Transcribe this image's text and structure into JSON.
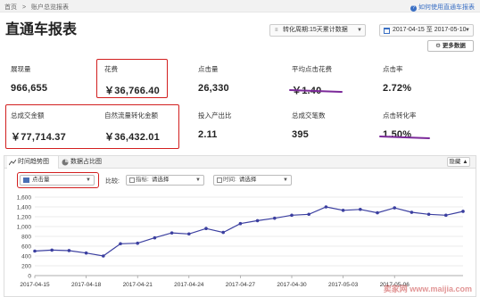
{
  "topbar": {
    "crumbs": [
      "首页",
      ">",
      "账户总览报表"
    ],
    "help": "如何使用直通车报表"
  },
  "title": "直通车报表",
  "controls": {
    "cycle": "转化周期:15天累计数据",
    "date_range": "2017-04-15 至 2017-05-10",
    "more": "更多数据"
  },
  "metrics": [
    {
      "label": "展现量",
      "value": "966,655"
    },
    {
      "label": "花费",
      "value": "￥36,766.40"
    },
    {
      "label": "点击量",
      "value": "26,330"
    },
    {
      "label": "平均点击花费",
      "value": "￥1.40"
    },
    {
      "label": "点击率",
      "value": "2.72%"
    },
    {
      "label": "总成交金额",
      "value": "￥77,714.37"
    },
    {
      "label": "自然流量转化金额",
      "value": "￥36,432.01"
    },
    {
      "label": "投入产出比",
      "value": "2.11"
    },
    {
      "label": "总成交笔数",
      "value": "395"
    },
    {
      "label": "点击转化率",
      "value": "1.50%"
    }
  ],
  "chart_panel": {
    "tabs": [
      "时间趋势图",
      "数据占比图"
    ],
    "hide": "隐藏",
    "metric_select": "点击量",
    "compare_label": "比较:",
    "index_select": {
      "key": "指标:",
      "value": "请选择"
    },
    "time_select": {
      "key": "时间:",
      "value": "请选择"
    },
    "watermark": "卖家网 www.maijia.com"
  },
  "colors": {
    "line": "#3b3fa0",
    "highlight_box": "#d21f1f",
    "underline": "#7c2a9a",
    "accent": "#3a6fc4"
  },
  "chart_data": {
    "type": "line",
    "title": "",
    "xlabel": "",
    "ylabel": "",
    "ylim": [
      0,
      1600
    ],
    "yticks": [
      0,
      200,
      400,
      600,
      800,
      1000,
      1200,
      1400,
      1600
    ],
    "xtick_labels": [
      "2017-04-15",
      "2017-04-18",
      "2017-04-21",
      "2017-04-24",
      "2017-04-27",
      "2017-04-30",
      "2017-05-03",
      "2017-05-06"
    ],
    "grid": true,
    "x": [
      "2017-04-15",
      "2017-04-16",
      "2017-04-17",
      "2017-04-18",
      "2017-04-19",
      "2017-04-20",
      "2017-04-21",
      "2017-04-22",
      "2017-04-23",
      "2017-04-24",
      "2017-04-25",
      "2017-04-26",
      "2017-04-27",
      "2017-04-28",
      "2017-04-29",
      "2017-04-30",
      "2017-05-01",
      "2017-05-02",
      "2017-05-03",
      "2017-05-04",
      "2017-05-05",
      "2017-05-06",
      "2017-05-07",
      "2017-05-08",
      "2017-05-09",
      "2017-05-10"
    ],
    "series": [
      {
        "name": "点击量",
        "values": [
          500,
          520,
          510,
          460,
          400,
          650,
          660,
          770,
          870,
          850,
          960,
          880,
          1060,
          1120,
          1170,
          1230,
          1250,
          1400,
          1330,
          1350,
          1280,
          1380,
          1290,
          1250,
          1230,
          1310
        ]
      }
    ]
  }
}
